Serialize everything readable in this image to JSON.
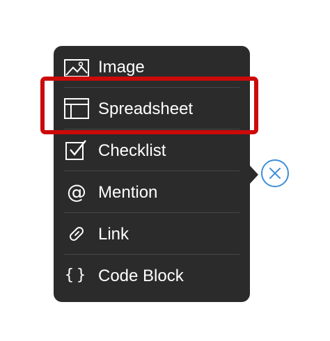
{
  "menu": {
    "items": [
      {
        "id": "image",
        "label": "Image",
        "icon": "image-icon"
      },
      {
        "id": "spreadsheet",
        "label": "Spreadsheet",
        "icon": "spreadsheet-icon",
        "highlighted": true
      },
      {
        "id": "checklist",
        "label": "Checklist",
        "icon": "checklist-icon"
      },
      {
        "id": "mention",
        "label": "Mention",
        "icon": "at-sign-icon"
      },
      {
        "id": "link",
        "label": "Link",
        "icon": "link-icon"
      },
      {
        "id": "code-block",
        "label": "Code Block",
        "icon": "braces-icon"
      }
    ]
  },
  "icons": {
    "mention_glyph": "@",
    "braces_glyph": "{}"
  },
  "colors": {
    "menu_background": "#2b2b2b",
    "menu_text": "#ffffff",
    "divider": "#474747",
    "highlight": "#cc0a0a",
    "close_accent": "#3d8fd9"
  }
}
